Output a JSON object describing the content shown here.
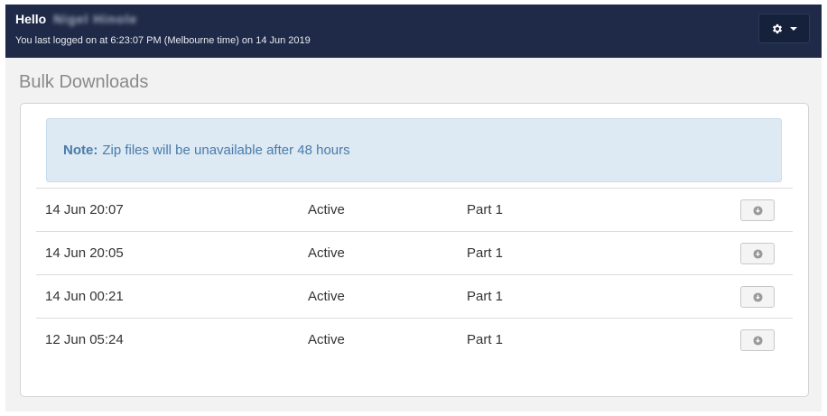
{
  "header": {
    "greeting": "Hello",
    "user_name": "Nigel Hinole",
    "last_login": "You last logged on at 6:23:07 PM (Melbourne time) on 14 Jun 2019",
    "settings_icon": "gear-icon"
  },
  "page": {
    "title": "Bulk Downloads"
  },
  "note": {
    "label": "Note:",
    "text": "Zip files will be unavailable after 48 hours"
  },
  "downloads": [
    {
      "date": "14 Jun 20:07",
      "status": "Active",
      "part": "Part 1",
      "icon": "download-icon"
    },
    {
      "date": "14 Jun 20:05",
      "status": "Active",
      "part": "Part 1",
      "icon": "download-icon"
    },
    {
      "date": "14 Jun 00:21",
      "status": "Active",
      "part": "Part 1",
      "icon": "download-icon"
    },
    {
      "date": "12 Jun 05:24",
      "status": "Active",
      "part": "Part 1",
      "icon": "download-icon"
    }
  ],
  "colors": {
    "header_bg": "#1e2a47",
    "page_bg": "#f2f2f2",
    "note_bg": "#dde9f3",
    "note_text": "#4a7baa"
  }
}
